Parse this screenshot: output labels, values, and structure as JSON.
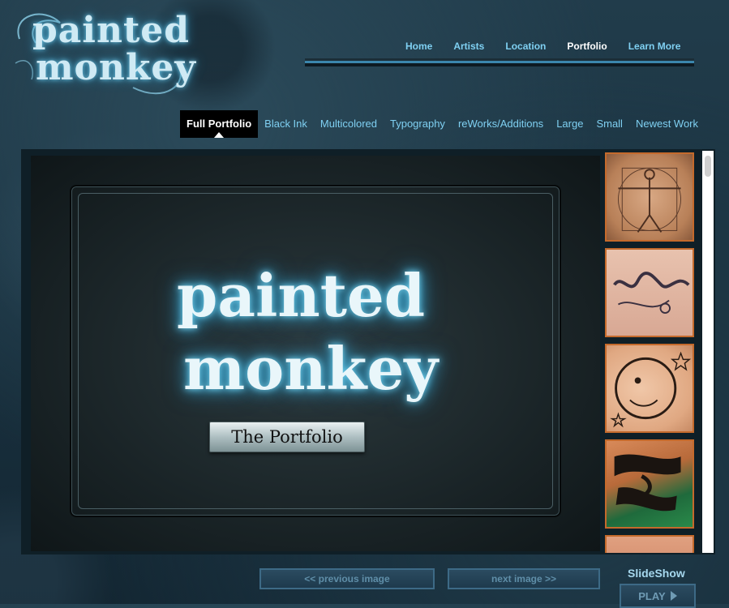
{
  "logo": {
    "line1": "painted",
    "line2": "monkey"
  },
  "topnav": {
    "items": [
      {
        "label": "Home",
        "active": false
      },
      {
        "label": "Artists",
        "active": false
      },
      {
        "label": "Location",
        "active": false
      },
      {
        "label": "Portfolio",
        "active": true
      },
      {
        "label": "Learn More",
        "active": false
      }
    ]
  },
  "subnav": {
    "items": [
      {
        "label": "Full Portfolio",
        "active": true
      },
      {
        "label": "Black Ink",
        "active": false
      },
      {
        "label": "Multicolored",
        "active": false
      },
      {
        "label": "Typography",
        "active": false
      },
      {
        "label": "reWorks/Additions",
        "active": false
      },
      {
        "label": "Large",
        "active": false
      },
      {
        "label": "Small",
        "active": false
      },
      {
        "label": "Newest Work",
        "active": false
      }
    ]
  },
  "main_image": {
    "title_line1": "painted",
    "title_line2": "monkey",
    "plaque": "The Portfolio"
  },
  "thumbnails": [
    {
      "icon": "vitruvian-tattoo-thumbnail"
    },
    {
      "icon": "script-christ-tattoo-thumbnail"
    },
    {
      "icon": "moon-face-tattoo-thumbnail"
    },
    {
      "icon": "tribal-sleeve-tattoo-thumbnail"
    },
    {
      "icon": "tattoo-thumbnail"
    }
  ],
  "controls": {
    "prev": "<< previous image",
    "next": "next image >>",
    "slideshow": "SlideShow",
    "play": "PLAY"
  },
  "colors": {
    "nav_link": "#7fd0f2",
    "nav_active": "#ffffff",
    "thumb_border": "#c46a2c",
    "button_border": "#3d6a86"
  }
}
